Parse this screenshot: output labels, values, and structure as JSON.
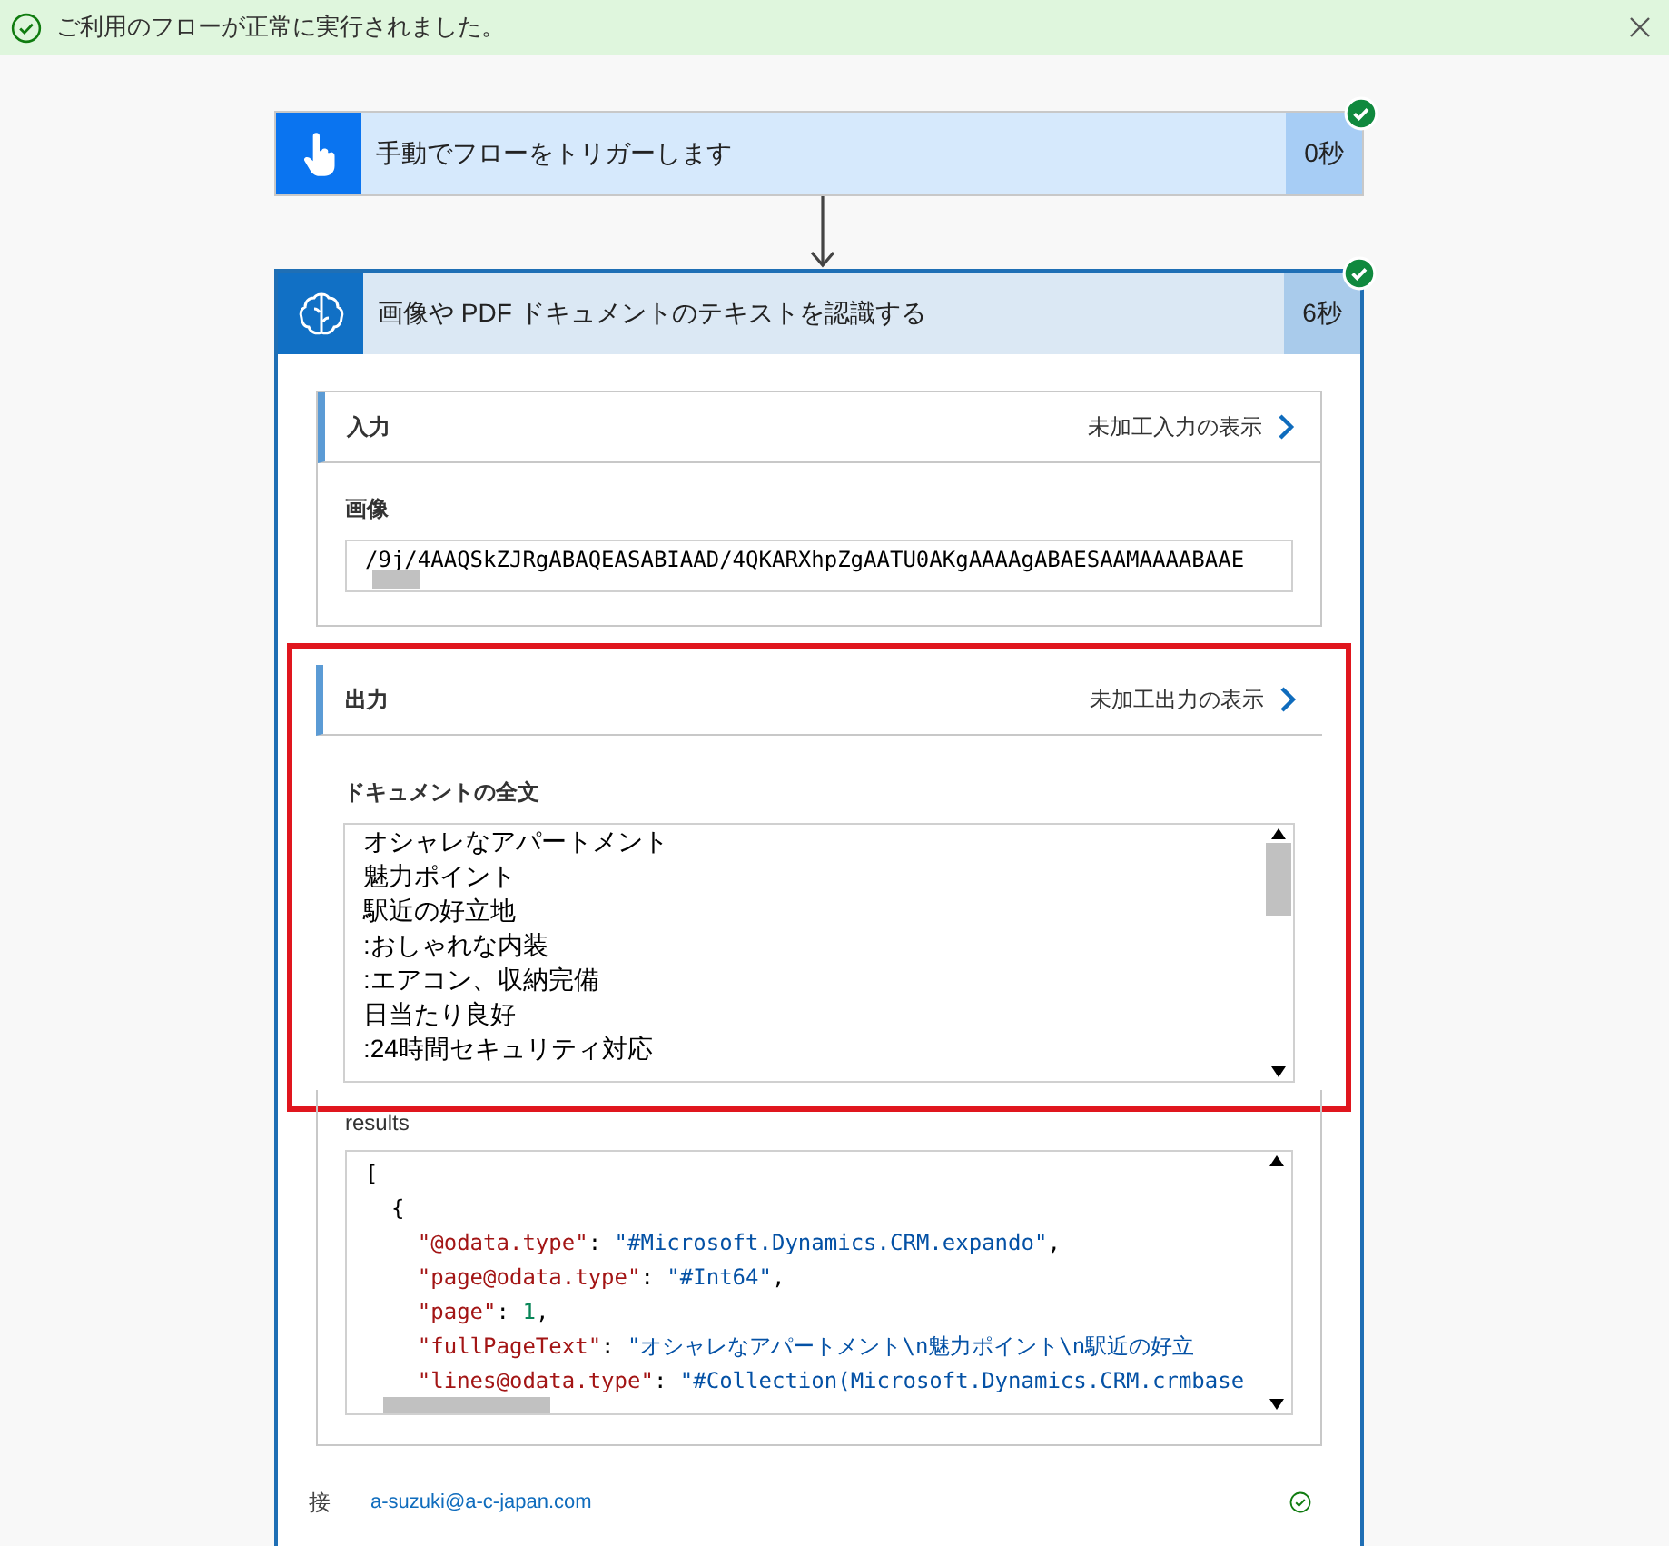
{
  "banner": {
    "message": "ご利用のフローが正常に実行されました。",
    "succeeded": true
  },
  "steps": [
    {
      "kind": "trigger",
      "title": "手動でフローをトリガーします",
      "duration": "0秒",
      "succeeded": true
    },
    {
      "kind": "ai",
      "title": "画像や PDF ドキュメントのテキストを認識する",
      "duration": "6秒",
      "succeeded": true,
      "input": {
        "heading": "入力",
        "raw_link": "未加工入力の表示",
        "fields": [
          {
            "label": "画像",
            "value": "/9j/4AAQSkZJRgABAQEASABIAAD/4QKARXhpZgAATU0AKgAAAAgABAESAAMAAAABAAE"
          }
        ]
      },
      "output": {
        "heading": "出力",
        "raw_link": "未加工出力の表示",
        "highlighted": true,
        "full_text": {
          "label": "ドキュメントの全文",
          "lines": [
            "オシャレなアパートメント",
            "魅力ポイント",
            "駅近の好立地",
            ":おしゃれな内装",
            ":エアコン、収納完備",
            "日当たり良好",
            ":24時間セキュリティ対応"
          ]
        },
        "results": {
          "label": "results",
          "lines": [
            [
              {
                "kind": "punct",
                "text": "["
              }
            ],
            [
              {
                "kind": "punct",
                "text": "  {"
              }
            ],
            [
              {
                "kind": "key",
                "text": "    \"@odata.type\""
              },
              {
                "kind": "punct",
                "text": ": "
              },
              {
                "kind": "string",
                "text": "\"#Microsoft.Dynamics.CRM.expando\""
              },
              {
                "kind": "punct",
                "text": ","
              }
            ],
            [
              {
                "kind": "key",
                "text": "    \"page@odata.type\""
              },
              {
                "kind": "punct",
                "text": ": "
              },
              {
                "kind": "string",
                "text": "\"#Int64\""
              },
              {
                "kind": "punct",
                "text": ","
              }
            ],
            [
              {
                "kind": "key",
                "text": "    \"page\""
              },
              {
                "kind": "punct",
                "text": ": "
              },
              {
                "kind": "number",
                "text": "1"
              },
              {
                "kind": "punct",
                "text": ","
              }
            ],
            [
              {
                "kind": "key",
                "text": "    \"fullPageText\""
              },
              {
                "kind": "punct",
                "text": ": "
              },
              {
                "kind": "string",
                "text": "\"オシャレなアパートメント\\n魅力ポイント\\n駅近の好立"
              }
            ],
            [
              {
                "kind": "key",
                "text": "    \"lines@odata.type\""
              },
              {
                "kind": "punct",
                "text": ": "
              },
              {
                "kind": "string",
                "text": "\"#Collection(Microsoft.Dynamics.CRM.crmbase"
              }
            ]
          ]
        }
      },
      "connection": {
        "label": "接",
        "account": "a-suzuki@a-c-japan.com",
        "ok": true
      }
    }
  ]
}
